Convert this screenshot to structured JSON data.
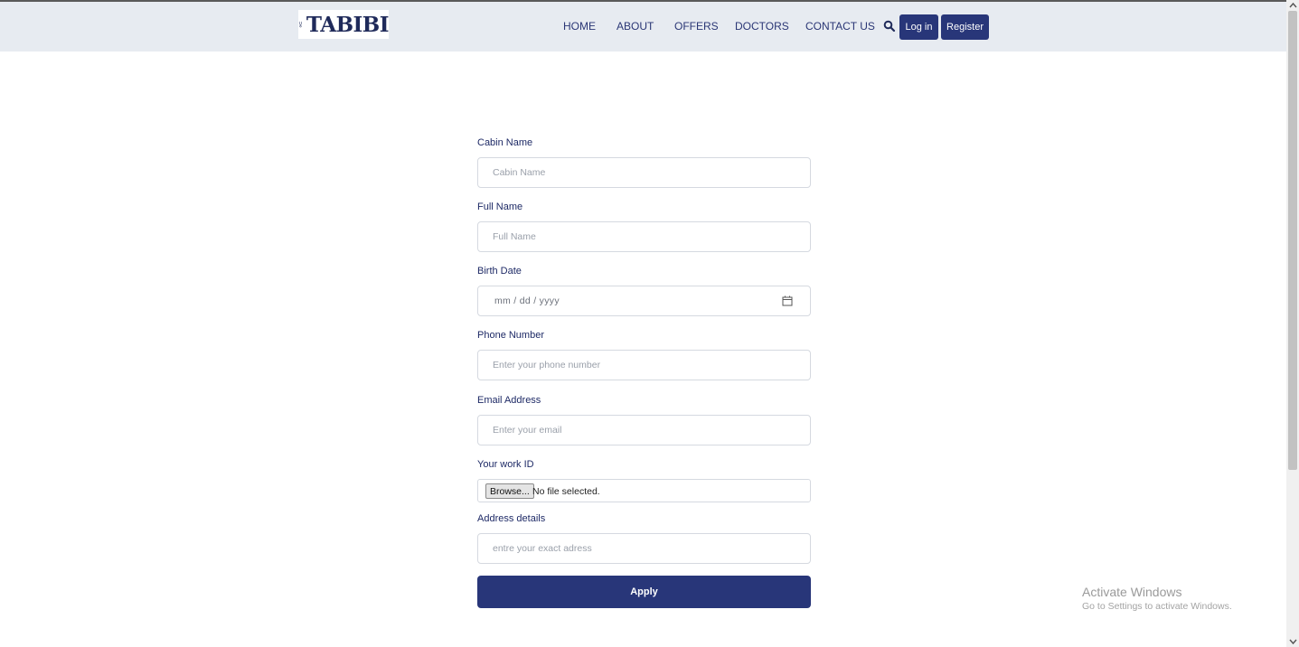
{
  "brand": {
    "logo_text": "TABIBI"
  },
  "nav": {
    "links": [
      "HOME",
      "ABOUT",
      "OFFERS",
      "DOCTORS",
      "CONTACT US"
    ],
    "login_label": "Log in",
    "register_label": "Register"
  },
  "form": {
    "cabin_name": {
      "label": "Cabin Name",
      "placeholder": "Cabin Name"
    },
    "full_name": {
      "label": "Full Name",
      "placeholder": "Full Name"
    },
    "birth_date": {
      "label": "Birth Date",
      "placeholder": "mm / dd / yyyy"
    },
    "phone": {
      "label": "Phone Number",
      "placeholder": "Enter your phone number"
    },
    "email": {
      "label": "Email Address",
      "placeholder": "Enter your email"
    },
    "work_id": {
      "label": "Your work ID",
      "browse_label": "Browse...",
      "status": "No file selected."
    },
    "address": {
      "label": "Address details",
      "placeholder": "entre your exact adress"
    },
    "submit_label": "Apply"
  },
  "watermark": {
    "title": "Activate Windows",
    "subtitle": "Go to Settings to activate Windows."
  },
  "colors": {
    "primary": "#283679",
    "navbar_bg": "#e7ebf1",
    "text": "#1e2a66"
  },
  "icons": [
    "stethoscope-icon",
    "search-icon",
    "calendar-icon",
    "scroll-up-arrow-icon",
    "scroll-down-arrow-icon"
  ]
}
